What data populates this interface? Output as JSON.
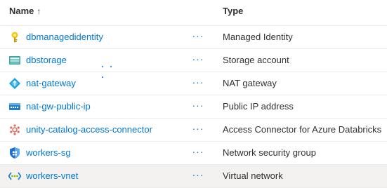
{
  "header": {
    "name_label": "Name",
    "sort_glyph": "↑",
    "type_label": "Type"
  },
  "rows": [
    {
      "name": "dbmanagedidentity",
      "type": "Managed Identity",
      "icon": "managed-identity-icon",
      "more": "···"
    },
    {
      "name": "dbstorage",
      "type": "Storage account",
      "icon": "storage-account-icon",
      "more": "···"
    },
    {
      "name": "nat-gateway",
      "type": "NAT gateway",
      "icon": "nat-gateway-icon",
      "more": "···"
    },
    {
      "name": "nat-gw-public-ip",
      "type": "Public IP address",
      "icon": "public-ip-icon",
      "more": "···"
    },
    {
      "name": "unity-catalog-access-connector",
      "type": "Access Connector for Azure Databricks",
      "icon": "access-connector-icon",
      "more": "···"
    },
    {
      "name": "workers-sg",
      "type": "Network security group",
      "icon": "network-security-group-icon",
      "more": "···"
    },
    {
      "name": "workers-vnet",
      "type": "Virtual network",
      "icon": "virtual-network-icon",
      "more": "···"
    }
  ],
  "colors": {
    "link": "#0078d4",
    "selected_row": "#f3f2f1",
    "divider": "#edebe9"
  }
}
